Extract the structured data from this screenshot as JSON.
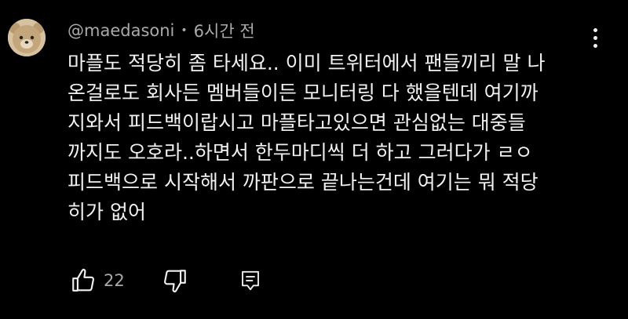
{
  "comment": {
    "author": "@maedasoni",
    "separator": "•",
    "time": "6시간 전",
    "lines": [
      "마플도 적당히 좀 타세요.. 이미 트위터에서 팬들끼리 말 나",
      "온걸로도 회사든 멤버들이든 모니터링 다 했을텐데 여기까",
      "지와서 피드백이랍시고 마플타고있으면 관심없는 대중들",
      "까지도 오호라..하면서 한두마디씩 더 하고 그러다가 ㄹㅇ",
      "피드백으로 시작해서 까판으로 끝나는건데 여기는 뭐 적당",
      "히가 없어"
    ],
    "like_count": "22"
  },
  "icons": {
    "avatar": "bear-avatar",
    "menu": "more-vert-icon",
    "like": "thumbs-up-icon",
    "dislike": "thumbs-down-icon",
    "reply": "comment-icon"
  },
  "colors": {
    "background": "#000000",
    "text": "#f1f1f1",
    "secondary": "#aaaaaa"
  }
}
